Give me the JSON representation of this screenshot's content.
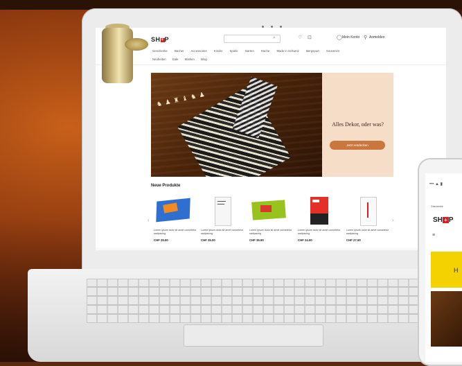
{
  "site": {
    "logo_prefix": "SH",
    "logo_plus": "+",
    "logo_suffix": "P",
    "account_label": "Anmelden",
    "wishlist_label": "Mein Konto",
    "nav_row1": [
      "Geschenke",
      "Bücher",
      "Accessoires",
      "Kinder",
      "Spiele",
      "Garten",
      "Küche",
      "Made in Schweiz",
      "Bergsport",
      "Souvenirs"
    ],
    "nav_row2": [
      "Neuheiten",
      "Sale",
      "Marken",
      "Blog"
    ]
  },
  "banner": {
    "headline": "Alles Dekor, oder was?",
    "cta": "Jetzt entdecken",
    "figures": "♞ ♟ ♜ ♝ ♞ ♟"
  },
  "products_section": {
    "title": "Neue Produkte",
    "prev_arrow": "‹",
    "next_arrow": "›",
    "items": [
      {
        "name": "Lorem ipsum dolor sit amet consetetur sadipscing",
        "price": "CHF 29.90"
      },
      {
        "name": "Lorem ipsum dolor sit amet consetetur sadipscing",
        "price": "CHF 35.00"
      },
      {
        "name": "Lorem ipsum dolor sit amet consetetur sadipscing",
        "price": "CHF 39.90"
      },
      {
        "name": "Lorem ipsum dolor sit amet consetetur sadipscing",
        "price": "CHF 24.90"
      },
      {
        "name": "Lorem ipsum dolor sit amet consetetur sadipscing",
        "price": "CHF 27.50"
      }
    ]
  },
  "phone": {
    "status_text": "••• ▲ ▮",
    "top_link": "Geschenke",
    "logo_prefix": "SH",
    "logo_plus": "+",
    "logo_suffix": "P",
    "menu_glyph": "≡",
    "yellow_text": "H"
  },
  "colors": {
    "brand_red": "#d81e1e",
    "banner_bg": "#f5ddc8",
    "cta_bg": "#c9763f",
    "phone_yellow": "#f4d100"
  }
}
